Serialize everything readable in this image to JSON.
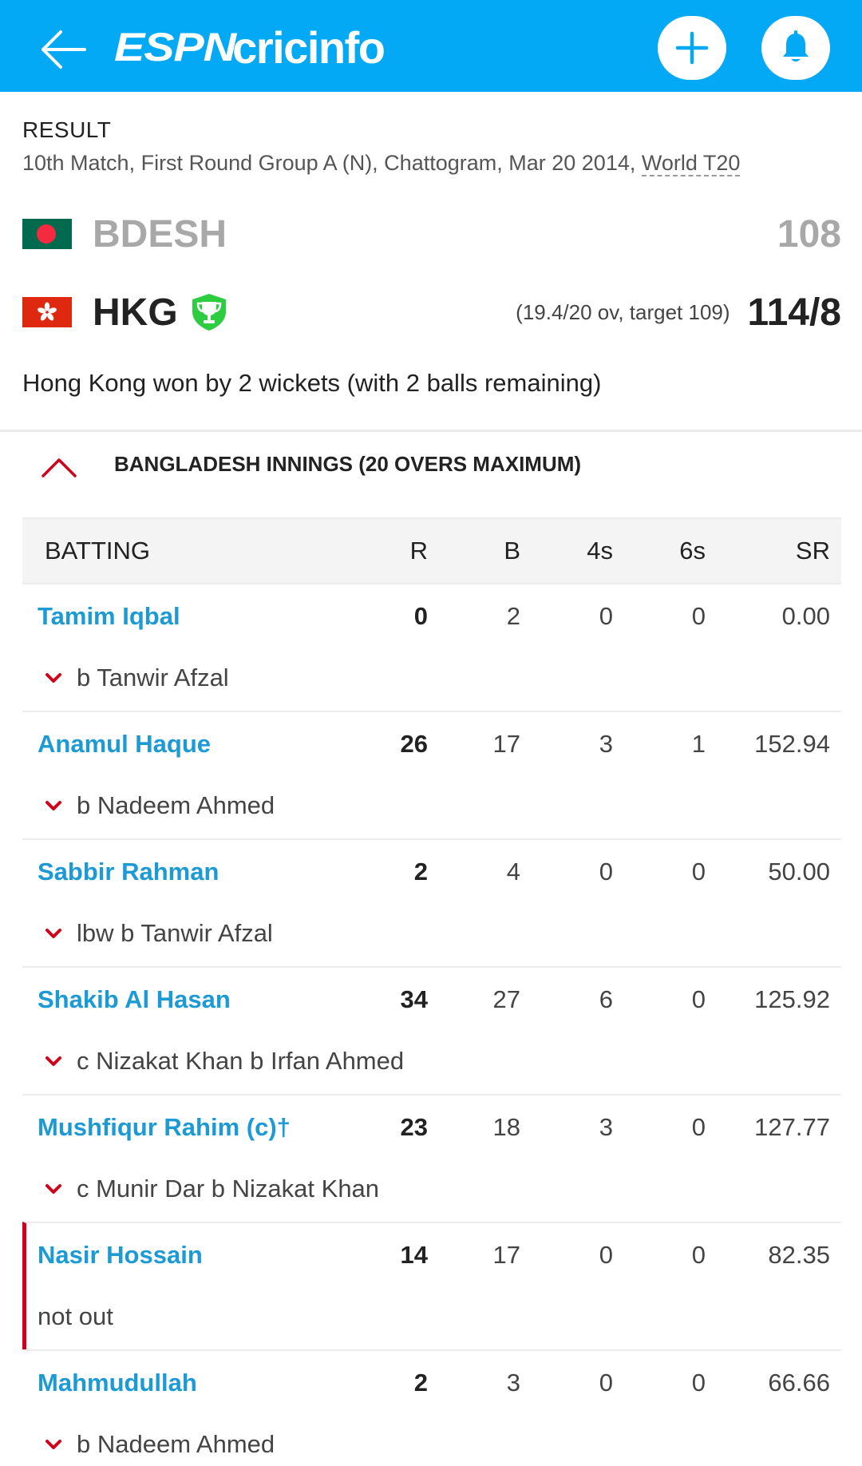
{
  "app": {
    "logo_espn": "ESPN",
    "logo_cricinfo": "cricinfo"
  },
  "colors": {
    "appbar": "#03a9f4",
    "player_link": "#1b9ad6",
    "accent_red": "#d0021b",
    "winner_badge": "#2ecc40"
  },
  "icons": {
    "back": "back-arrow-icon",
    "add": "plus-icon",
    "notifications": "bell-icon",
    "winner": "trophy-icon",
    "collapse": "chevron-up-icon",
    "expand_dismissal": "chevron-down-icon"
  },
  "match": {
    "status": "RESULT",
    "meta": "10th Match, First Round Group A (N), Chattogram, Mar 20 2014, ",
    "series": "World T20",
    "result": "Hong Kong won by 2 wickets (with 2 balls remaining)"
  },
  "teams": [
    {
      "abbr": "BDESH",
      "score": "108",
      "overs_info": ""
    },
    {
      "abbr": "HKG",
      "score": "114/8",
      "overs_info": "(19.4/20 ov, target 109)"
    }
  ],
  "innings": {
    "title": "BANGLADESH INNINGS (20 OVERS MAXIMUM)",
    "headers": {
      "batting": "BATTING",
      "r": "R",
      "b": "B",
      "fours": "4s",
      "sixes": "6s",
      "sr": "SR"
    },
    "batters": [
      {
        "name": "Tamim Iqbal",
        "r": "0",
        "b": "2",
        "fours": "0",
        "sixes": "0",
        "sr": "0.00",
        "dismissal": "b Tanwir Afzal"
      },
      {
        "name": "Anamul Haque",
        "r": "26",
        "b": "17",
        "fours": "3",
        "sixes": "1",
        "sr": "152.94",
        "dismissal": "b Nadeem Ahmed"
      },
      {
        "name": "Sabbir Rahman",
        "r": "2",
        "b": "4",
        "fours": "0",
        "sixes": "0",
        "sr": "50.00",
        "dismissal": "lbw b Tanwir Afzal"
      },
      {
        "name": "Shakib Al Hasan",
        "r": "34",
        "b": "27",
        "fours": "6",
        "sixes": "0",
        "sr": "125.92",
        "dismissal": "c Nizakat Khan b Irfan Ahmed"
      },
      {
        "name": "Mushfiqur Rahim (c)†",
        "r": "23",
        "b": "18",
        "fours": "3",
        "sixes": "0",
        "sr": "127.77",
        "dismissal": "c Munir Dar b Nizakat Khan"
      },
      {
        "name": "Nasir Hossain",
        "r": "14",
        "b": "17",
        "fours": "0",
        "sixes": "0",
        "sr": "82.35",
        "dismissal": "not out"
      },
      {
        "name": "Mahmudullah",
        "r": "2",
        "b": "3",
        "fours": "0",
        "sixes": "0",
        "sr": "66.66",
        "dismissal": "b Nadeem Ahmed"
      }
    ]
  }
}
